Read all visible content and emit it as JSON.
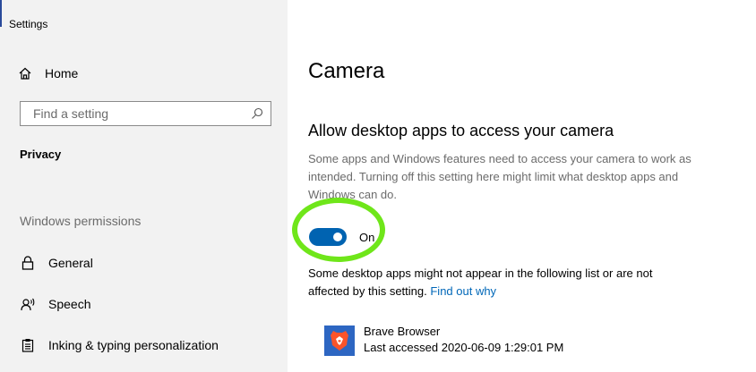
{
  "window": {
    "title": "Settings"
  },
  "sidebar": {
    "home_label": "Home",
    "search_placeholder": "Find a setting",
    "section_title": "Privacy",
    "permissions_heading": "Windows permissions",
    "items": [
      {
        "label": "General",
        "icon": "lock-icon"
      },
      {
        "label": "Speech",
        "icon": "speech-icon"
      },
      {
        "label": "Inking & typing personalization",
        "icon": "clipboard-icon"
      }
    ]
  },
  "main": {
    "title": "Camera",
    "subheading": "Allow desktop apps to access your camera",
    "description": "Some apps and Windows features need to access your camera to work as intended. Turning off this setting here might limit what desktop apps and Windows can do.",
    "toggle": {
      "state_label": "On",
      "on": true
    },
    "info_text": "Some desktop apps might not appear in the following list or are not affected by this setting.",
    "info_link": "Find out why",
    "apps": [
      {
        "name": "Brave Browser",
        "last_accessed": "Last accessed 2020-06-09 1:29:01 PM",
        "icon": "brave-browser-icon"
      }
    ]
  },
  "colors": {
    "sidebar_bg": "#f2f2f2",
    "accent": "#0063b1",
    "link": "#0067b8",
    "highlight_circle": "#6fe61a",
    "app_icon_bg": "#2d66c2"
  }
}
